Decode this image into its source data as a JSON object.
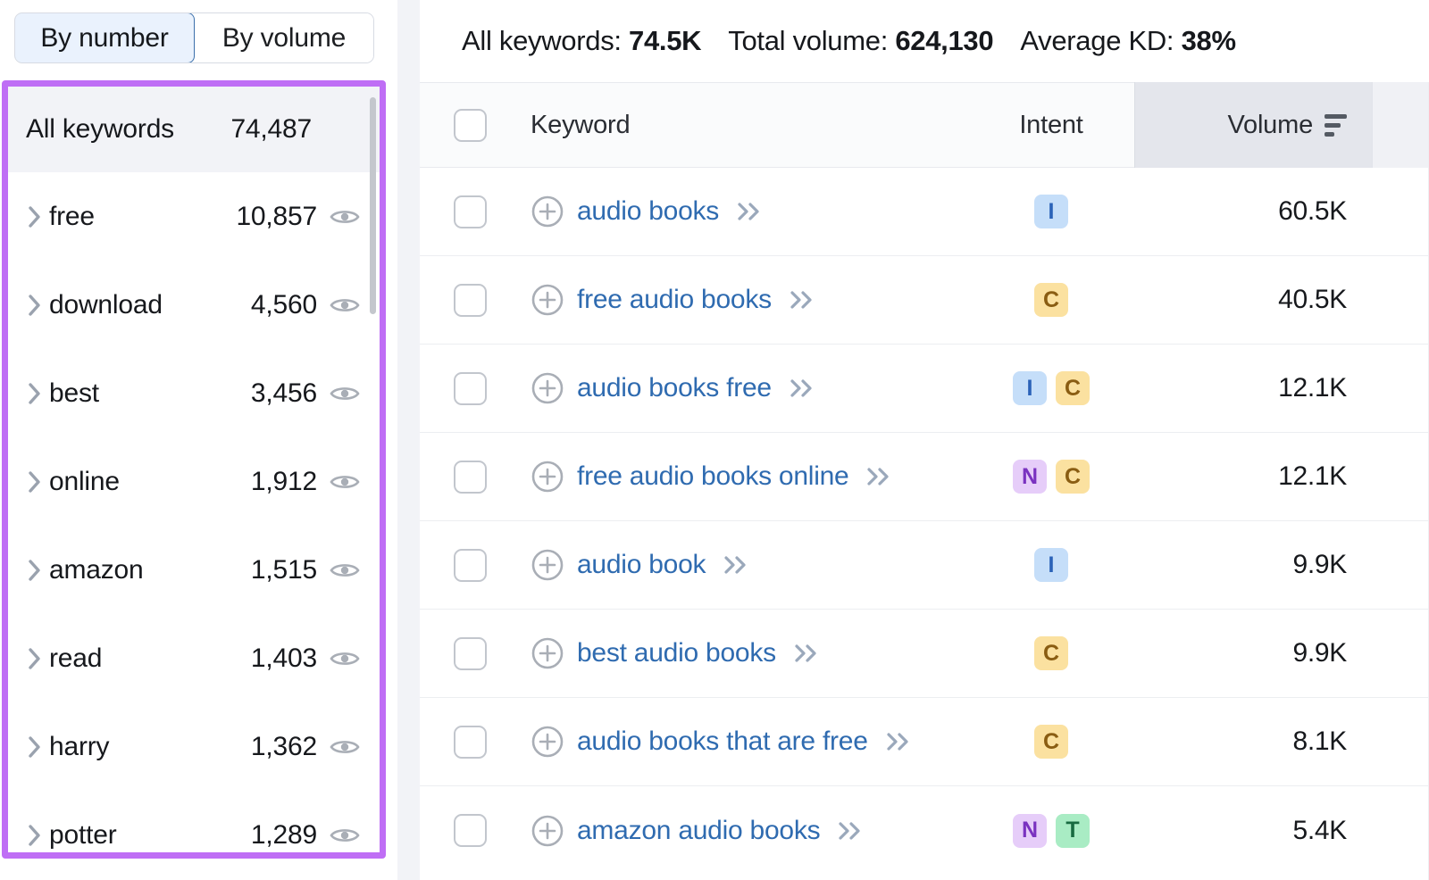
{
  "sidebar": {
    "toggle": {
      "options": [
        {
          "label": "By number",
          "active": true
        },
        {
          "label": "By volume",
          "active": false
        }
      ]
    },
    "all_row": {
      "label": "All keywords",
      "count": "74,487"
    },
    "groups": [
      {
        "label": "free",
        "count": "10,857"
      },
      {
        "label": "download",
        "count": "4,560"
      },
      {
        "label": "best",
        "count": "3,456"
      },
      {
        "label": "online",
        "count": "1,912"
      },
      {
        "label": "amazon",
        "count": "1,515"
      },
      {
        "label": "read",
        "count": "1,403"
      },
      {
        "label": "harry",
        "count": "1,362"
      },
      {
        "label": "potter",
        "count": "1,289"
      }
    ],
    "icons": {
      "expand": "chevron-right-icon",
      "visibility": "eye-icon"
    },
    "highlight_color": "#bf6ef5"
  },
  "summary": {
    "all_keywords_label": "All keywords:",
    "all_keywords_value": "74.5K",
    "total_volume_label": "Total volume:",
    "total_volume_value": "624,130",
    "average_kd_label": "Average KD:",
    "average_kd_value": "38%"
  },
  "table": {
    "columns": {
      "keyword": "Keyword",
      "intent": "Intent",
      "volume": "Volume"
    },
    "sort": {
      "column": "Volume",
      "direction": "descending",
      "icon": "sort-descending-icon"
    },
    "rows": [
      {
        "keyword": "audio books",
        "intents": [
          "I"
        ],
        "volume": "60.5K"
      },
      {
        "keyword": "free audio books",
        "intents": [
          "C"
        ],
        "volume": "40.5K"
      },
      {
        "keyword": "audio books free",
        "intents": [
          "I",
          "C"
        ],
        "volume": "12.1K"
      },
      {
        "keyword": "free audio books online",
        "intents": [
          "N",
          "C"
        ],
        "volume": "12.1K"
      },
      {
        "keyword": "audio book",
        "intents": [
          "I"
        ],
        "volume": "9.9K"
      },
      {
        "keyword": "best audio books",
        "intents": [
          "C"
        ],
        "volume": "9.9K"
      },
      {
        "keyword": "audio books that are free",
        "intents": [
          "C"
        ],
        "volume": "8.1K"
      },
      {
        "keyword": "amazon audio books",
        "intents": [
          "N",
          "T"
        ],
        "volume": "5.4K"
      }
    ]
  },
  "colors": {
    "keyword_link": "#2f6bb0",
    "intent_informational": "#c5def9",
    "intent_commercial": "#fbe1a0",
    "intent_navigational": "#e6cdf9",
    "intent_transactional": "#a9ecc4",
    "highlight_border": "#bf6ef5"
  }
}
